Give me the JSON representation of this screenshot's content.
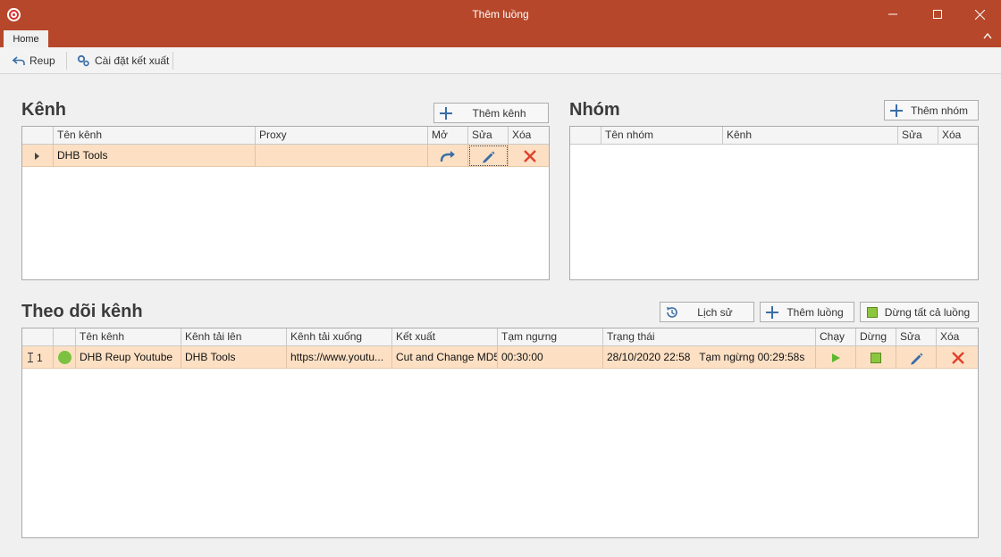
{
  "window": {
    "title": "Thêm luồng"
  },
  "ribbon": {
    "tab_home": "Home",
    "reup_label": "Reup",
    "export_settings_label": "Cài đặt kết xuất"
  },
  "channels": {
    "title": "Kênh",
    "add_button": "Thêm kênh",
    "columns": [
      "Tên kênh",
      "Proxy",
      "Mở",
      "Sửa",
      "Xóa"
    ],
    "rows": [
      {
        "name": "DHB Tools",
        "proxy": ""
      }
    ]
  },
  "groups": {
    "title": "Nhóm",
    "add_button": "Thêm nhóm",
    "columns": [
      "Tên nhóm",
      "Kênh",
      "Sửa",
      "Xóa"
    ],
    "rows": []
  },
  "monitor": {
    "title": "Theo dõi kênh",
    "history_button": "Lịch sử",
    "add_stream_button": "Thêm luồng",
    "stop_all_button": "Dừng tất cả luồng",
    "columns": [
      "Tên kênh",
      "Kênh tải lên",
      "Kênh tải xuống",
      "Kết xuất",
      "Tạm ngưng",
      "Trạng thái",
      "Chạy",
      "Dừng",
      "Sửa",
      "Xóa"
    ],
    "rows": [
      {
        "index": "1",
        "status_color": "#7cc142",
        "name": "DHB Reup Youtube",
        "upload_channel": "DHB Tools",
        "download_channel": "https://www.youtu...",
        "export": "Cut and Change MD5",
        "pause": "00:30:00",
        "status": "28/10/2020 22:58   Tạm ngừng 00:29:58s"
      }
    ]
  },
  "colors": {
    "titlebar": "#b7472a",
    "row_selected": "#fde0c4",
    "accent_blue": "#3a6ea5",
    "delete_red": "#e0402a",
    "run_green": "#5cb82e"
  }
}
